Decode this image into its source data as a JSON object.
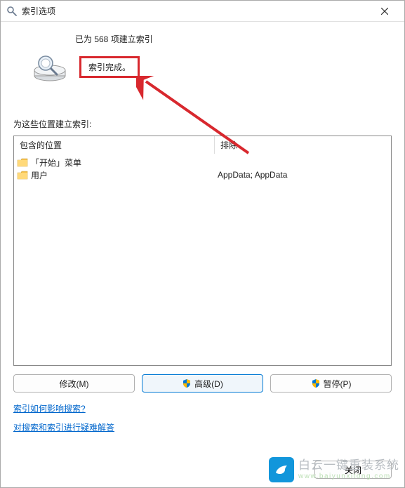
{
  "titlebar": {
    "title": "索引选项"
  },
  "status": {
    "count_text": "已为 568 项建立索引",
    "done_text": "索引完成。"
  },
  "locations": {
    "label": "为这些位置建立索引:",
    "col_included": "包含的位置",
    "col_excluded": "排除",
    "rows": [
      {
        "name": "「开始」菜单",
        "excluded": ""
      },
      {
        "name": "用户",
        "excluded": "AppData; AppData"
      }
    ]
  },
  "buttons": {
    "modify": "修改(M)",
    "advanced": "高级(D)",
    "pause": "暂停(P)"
  },
  "links": {
    "how_affects": "索引如何影响搜索?",
    "troubleshoot": "对搜索和索引进行疑难解答"
  },
  "footer": {
    "close": "关闭"
  },
  "watermark": {
    "zh": "白云一键重装系统",
    "en": "www.baiyunxitong.com"
  }
}
